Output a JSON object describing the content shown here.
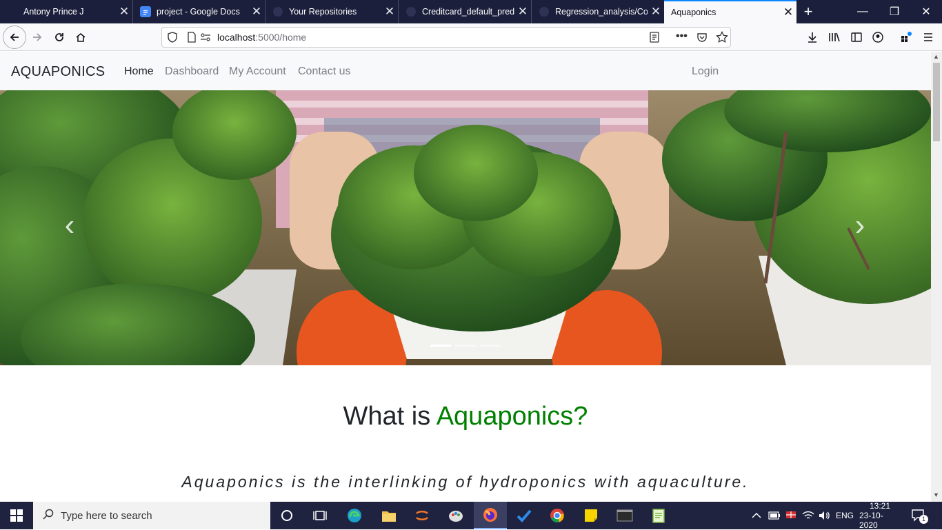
{
  "browser": {
    "tabs": [
      {
        "label": "Antony Prince J",
        "favicon": "person-icon",
        "color": "#2b2f55"
      },
      {
        "label": "project - Google Docs",
        "favicon": "google-docs-icon",
        "color": "#4285f4"
      },
      {
        "label": "Your Repositories",
        "favicon": "github-icon",
        "color": "#2b2f55"
      },
      {
        "label": "Creditcard_default_predi",
        "favicon": "github-icon",
        "color": "#2b2f55"
      },
      {
        "label": "Regression_analysis/Corr",
        "favicon": "github-icon",
        "color": "#2b2f55"
      },
      {
        "label": "Aquaponics",
        "favicon": "page-icon",
        "color": "#f9f9fb"
      }
    ],
    "close_glyph": "✕",
    "new_tab_glyph": "+",
    "url_host": "localhost",
    "url_rest": ":5000/home",
    "window_controls": {
      "minimize": "—",
      "restore": "❐",
      "close": "✕"
    }
  },
  "page": {
    "brand": "AQUAPONICS",
    "nav": [
      "Home",
      "Dashboard",
      "My Account",
      "Contact us"
    ],
    "login": "Login",
    "carousel": {
      "prev": "‹",
      "next": "›",
      "indicators": 3,
      "active_indicator": 0
    },
    "heading_prefix": "What is ",
    "heading_accent": "Aquaponics?",
    "tagline": "Aquaponics is the interlinking of hydroponics with aquaculture.",
    "accent_color": "#008000"
  },
  "taskbar": {
    "search_placeholder": "Type here to search",
    "language": "ENG",
    "time": "13:21",
    "date": "23-10-2020",
    "notification_count": "1"
  }
}
